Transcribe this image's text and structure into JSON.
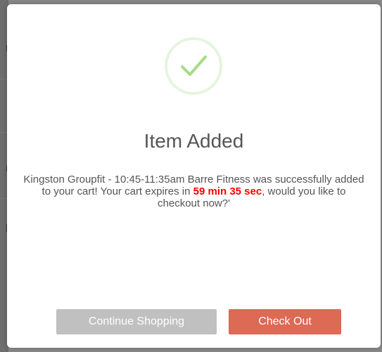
{
  "background": {
    "fragments": [
      "t",
      "r",
      "N"
    ]
  },
  "dialog": {
    "title": "Item Added",
    "message": {
      "part1": "Kingston Groupfit - 10:45-11:35am Barre Fitness was successfully added to your cart! Your cart expires in ",
      "timer": "59 min 35 sec",
      "part2": ", would you like to checkout now?'"
    },
    "success_icon": "checkmark-icon",
    "continue_label": "Continue Shopping",
    "checkout_label": "Check Out"
  },
  "colors": {
    "checkmark": "#a5dc86",
    "timer": "#ff0000",
    "continue_button": "#c0c0c0",
    "checkout_button": "#dc6a55"
  }
}
